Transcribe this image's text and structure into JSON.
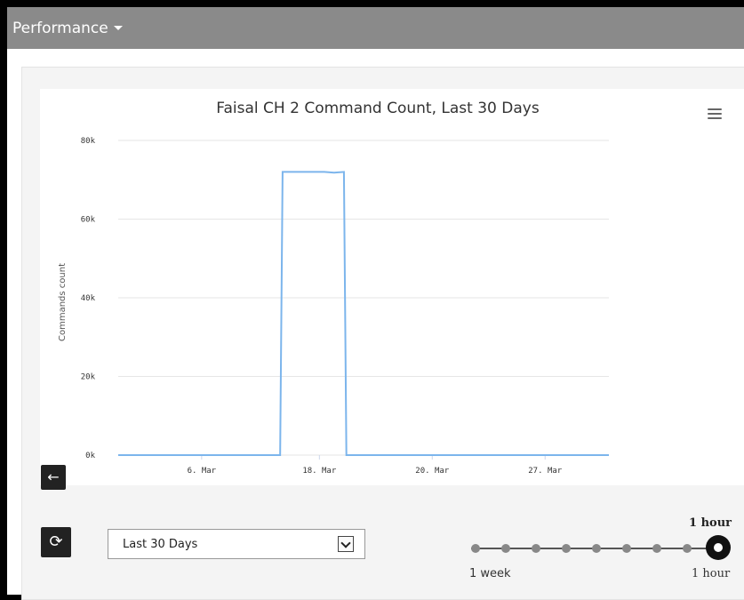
{
  "header": {
    "title": "Performance"
  },
  "chart_data": {
    "type": "line",
    "title": "Faisal CH 2 Command Count, Last 30 Days",
    "xlabel": "",
    "ylabel": "Commands count",
    "ylim": [
      0,
      80000
    ],
    "yticks": [
      "0k",
      "20k",
      "40k",
      "60k",
      "80k"
    ],
    "xticks": [
      "6. Mar",
      "18. Mar",
      "20. Mar",
      "27. Mar"
    ],
    "grid": true,
    "series": [
      {
        "color": "#7cb5ec",
        "x": [
          0,
          0.33,
          0.335,
          0.42,
          0.44,
          0.46,
          0.465,
          1.0
        ],
        "y": [
          0,
          0,
          72000,
          72000,
          71800,
          72000,
          0,
          0
        ]
      }
    ]
  },
  "controls": {
    "back_icon": "arrow-left-icon",
    "refresh_icon": "refresh-icon",
    "range_value": "Last 30 Days",
    "slider": {
      "current_label": "1 hour",
      "min_label": "1 week",
      "max_label": "1 hour",
      "position": 1.0
    }
  }
}
